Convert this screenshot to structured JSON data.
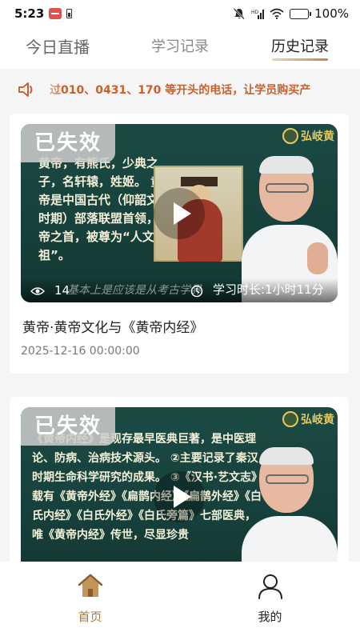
{
  "status_bar": {
    "time": "5:23",
    "battery": "100%"
  },
  "tabs": [
    {
      "label": "今日直播",
      "active": false
    },
    {
      "label": "学习记录",
      "active": false
    },
    {
      "label": "历史记录",
      "active": true
    }
  ],
  "notice": {
    "text": "过010、0431、170 等开头的电话，让学员购买产"
  },
  "cards": [
    {
      "badge": "已失效",
      "thumb_text": "黄帝，有熊氏，少典之子，名轩辕，姓姬。 黄帝是中国古代（仰韶文化时期）部落联盟首领，五帝之首，被尊为“人文初祖”。",
      "subtitle": "基本上是应该是从考古学界",
      "logo": "弘岐黄",
      "views": "14",
      "study_time": "学习时长:1小时11分",
      "title": "黄帝·黄帝文化与《黄帝内经》",
      "date": "2025-12-16 00:00:00"
    },
    {
      "badge": "已失效",
      "thumb_text": "《黄帝内经》是现存最早医典巨著，是中医理论、防病、治病技术源头。 ②主要记录了秦汉时期生命科学研究的成果。 ③《汉书·艺文志》载有《黄帝外经》《扁鹊内经》《扁鹊外经》《白氏内经》《白氏外经》《白氏旁篇》七部医典，唯《黄帝内经》传世，尽显珍贵",
      "logo": "弘岐黄"
    }
  ],
  "bottom_nav": [
    {
      "label": "首页",
      "icon": "home-icon",
      "active": true
    },
    {
      "label": "我的",
      "icon": "user-icon",
      "active": false
    }
  ],
  "colors": {
    "accent": "#a87a3d",
    "notice": "#c9612d",
    "thumb_bg": "#1b4a44"
  }
}
